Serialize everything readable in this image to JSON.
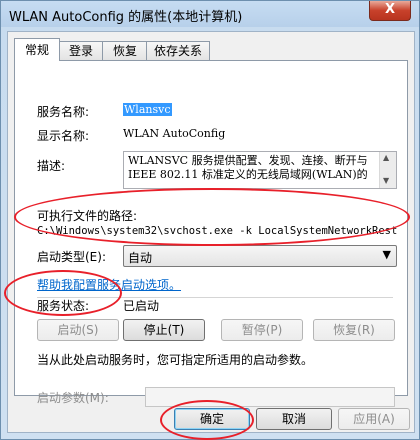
{
  "window": {
    "title": "WLAN AutoConfig 的属性(本地计算机)",
    "close_glyph": "X"
  },
  "tabs": [
    {
      "label": "常规",
      "active": true
    },
    {
      "label": "登录",
      "active": false
    },
    {
      "label": "恢复",
      "active": false
    },
    {
      "label": "依存关系",
      "active": false
    }
  ],
  "general": {
    "service_name_label": "服务名称:",
    "service_name_value": "Wlansvc",
    "display_name_label": "显示名称:",
    "display_name_value": "WLAN AutoConfig",
    "description_label": "描述:",
    "description_line1": "WLANSVC 服务提供配置、发现、连接、断开与",
    "description_line2": "IEEE 802.11 标准定义的无线局域网(WLAN)的",
    "exe_path_label": "可执行文件的路径:",
    "exe_path_value": "C:\\Windows\\system32\\svchost.exe -k LocalSystemNetworkRestri",
    "startup_type_label": "启动类型(E):",
    "startup_type_value": "自动",
    "help_link": "帮助我配置服务启动选项。",
    "service_status_label": "服务状态:",
    "service_status_value": "已启动",
    "start_button": "启动(S)",
    "stop_button": "停止(T)",
    "pause_button": "暂停(P)",
    "resume_button": "恢复(R)",
    "hint_text": "当从此处启动服务时，您可指定所适用的启动参数。",
    "start_params_label": "启动参数(M):",
    "start_params_value": ""
  },
  "footer": {
    "ok_button": "确定",
    "cancel_button": "取消",
    "apply_button": "应用(A)"
  },
  "colors": {
    "annotation_red": "#e8202a",
    "link_blue": "#0066cc",
    "selection_blue": "#3399ff"
  }
}
